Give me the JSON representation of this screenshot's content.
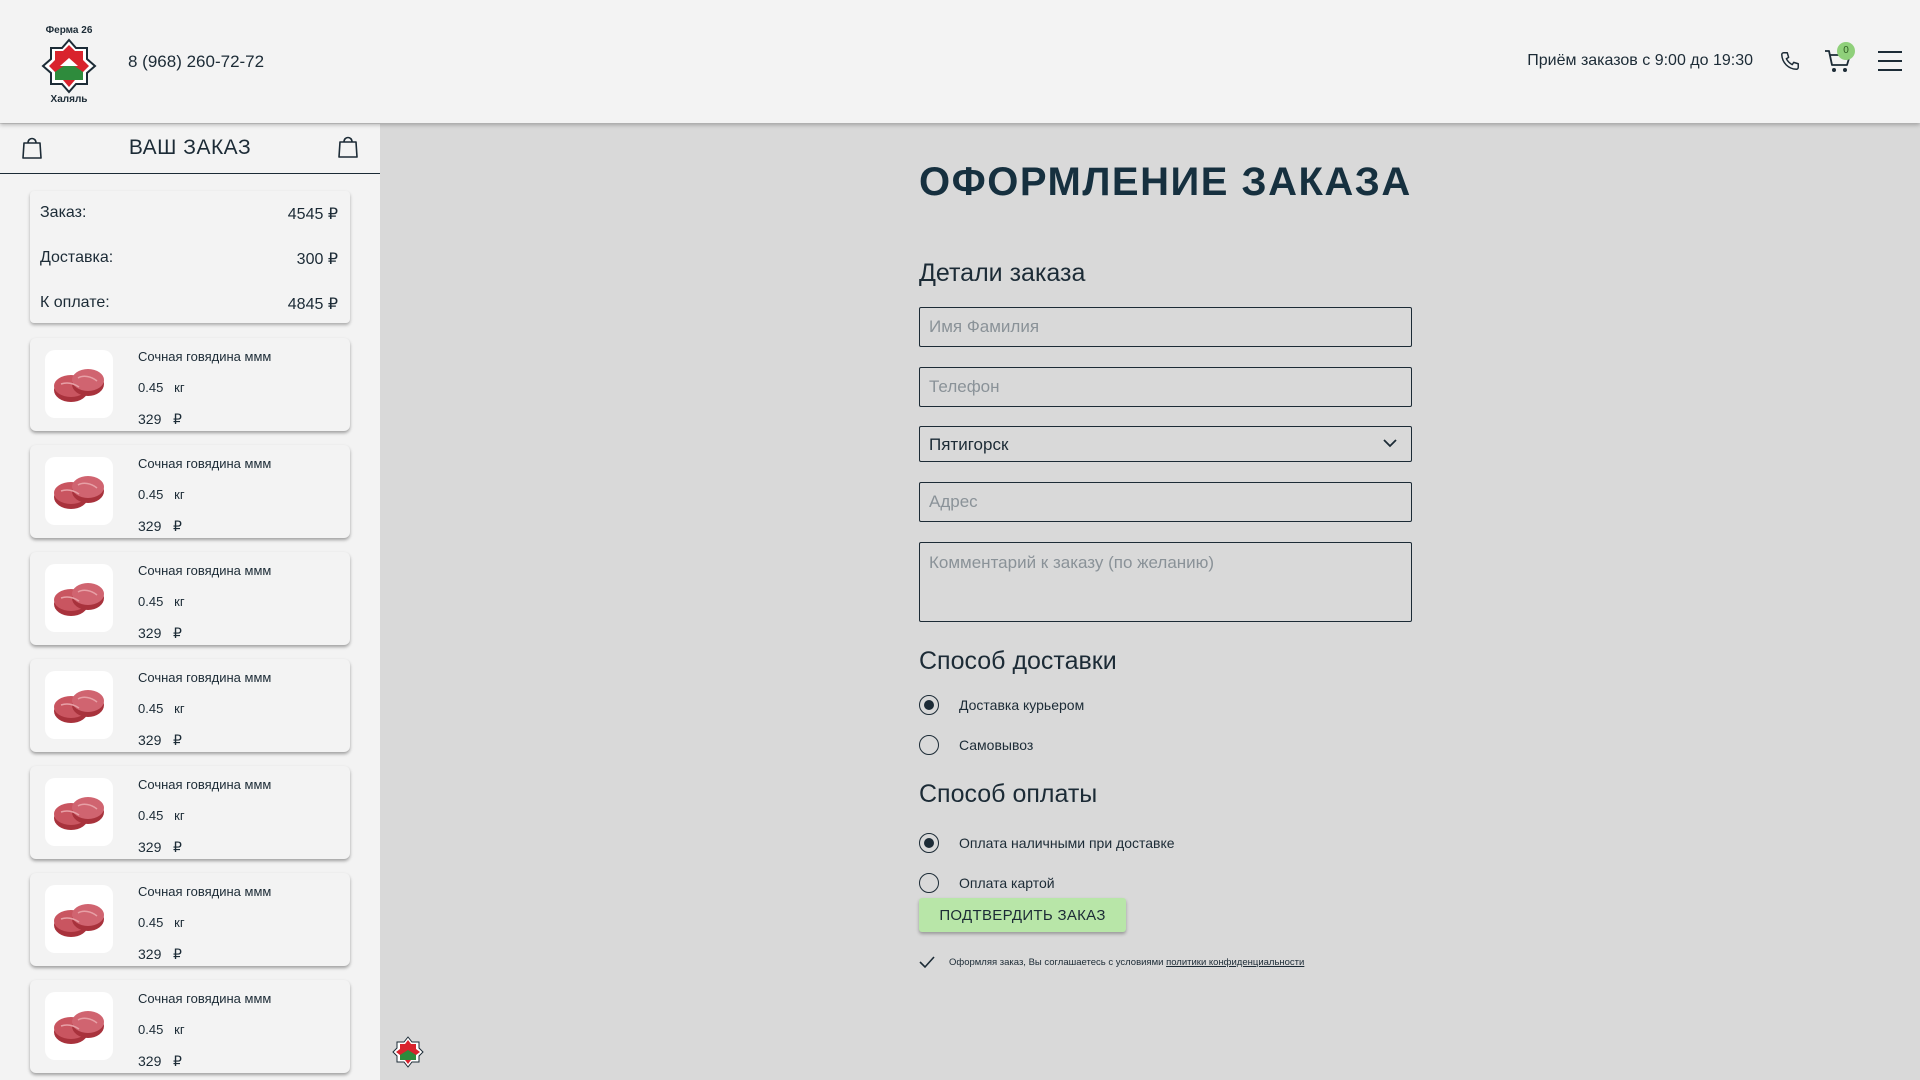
{
  "header": {
    "phone": "8 (968) 260-72-72",
    "hours": "Приём заказов с 9:00 до 19:30",
    "cart_count": "0"
  },
  "sidebar": {
    "title": "ВАШ ЗАКАЗ",
    "totals": [
      {
        "label": "Заказ:",
        "value": "4545 ₽"
      },
      {
        "label": "Доставка:",
        "value": "300 ₽"
      },
      {
        "label": "К оплате:",
        "value": "4845 ₽"
      }
    ],
    "items": [
      {
        "name": "Сочная говядина ммм",
        "weight": "0.45   кг",
        "price": "329   ₽"
      },
      {
        "name": "Сочная говядина ммм",
        "weight": "0.45   кг",
        "price": "329   ₽"
      },
      {
        "name": "Сочная говядина ммм",
        "weight": "0.45   кг",
        "price": "329   ₽"
      },
      {
        "name": "Сочная говядина ммм",
        "weight": "0.45   кг",
        "price": "329   ₽"
      },
      {
        "name": "Сочная говядина ммм",
        "weight": "0.45   кг",
        "price": "329   ₽"
      },
      {
        "name": "Сочная говядина ммм",
        "weight": "0.45   кг",
        "price": "329   ₽"
      },
      {
        "name": "Сочная говядина ммм",
        "weight": "0.45   кг",
        "price": "329   ₽"
      }
    ]
  },
  "form": {
    "title": "ОФОРМЛЕНИЕ ЗАКАЗА",
    "details_heading": "Детали заказа",
    "name_placeholder": "Имя Фамилия",
    "phone_placeholder": "Телефон",
    "city_value": "Пятигорск",
    "address_placeholder": "Адрес",
    "comment_placeholder": "Комментарий к заказу (по желанию)",
    "delivery_heading": "Способ доставки",
    "delivery_options": [
      {
        "label": "Доставка курьером",
        "selected": true
      },
      {
        "label": "Самовывоз",
        "selected": false
      }
    ],
    "payment_heading": "Способ оплаты",
    "payment_options": [
      {
        "label": "Оплата наличными при доставке",
        "selected": true
      },
      {
        "label": "Оплата картой",
        "selected": false
      }
    ],
    "submit_label": "ПОДТВЕРДИТЬ ЗАКАЗ",
    "agree_text": "Оформляя заказ, Вы соглашаетесь с условиями ",
    "agree_link": "политики конфиденциальности"
  },
  "colors": {
    "primary": "#1c2b36",
    "title": "#16303f",
    "accent_green": "#b8e6a8",
    "badge": "#8fd07a",
    "brand_red": "#d9232d",
    "brand_green": "#2e8b3c"
  },
  "icons": [
    "logo",
    "phone-icon",
    "cart-icon",
    "menu-icon",
    "bag-icon",
    "chevron-down-icon",
    "checkmark-icon"
  ]
}
